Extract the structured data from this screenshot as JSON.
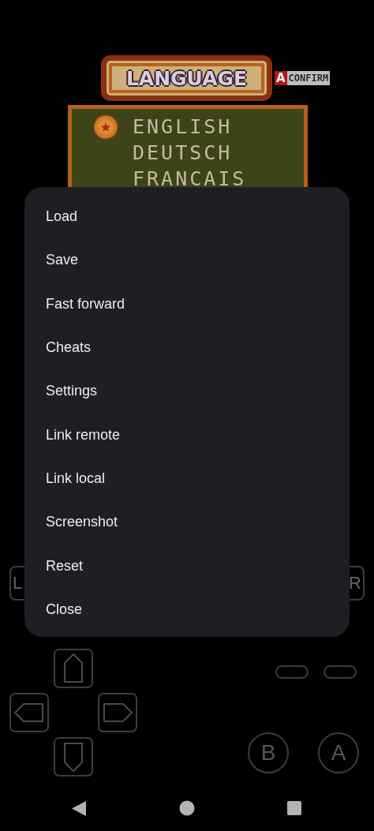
{
  "game_screen": {
    "title": "LANGUAGE",
    "confirm_key": "A",
    "confirm_label": "CONFIRM",
    "languages": [
      {
        "label": "ENGLISH",
        "selected": true
      },
      {
        "label": "DEUTSCH",
        "selected": false
      },
      {
        "label": "FRANCAIS",
        "selected": false
      }
    ]
  },
  "menu": {
    "items": [
      "Load",
      "Save",
      "Fast forward",
      "Cheats",
      "Settings",
      "Link remote",
      "Link local",
      "Screenshot",
      "Reset",
      "Close"
    ]
  },
  "controls": {
    "shoulder_buttons": [
      "L",
      "R"
    ],
    "face_buttons": [
      "B",
      "A"
    ]
  }
}
